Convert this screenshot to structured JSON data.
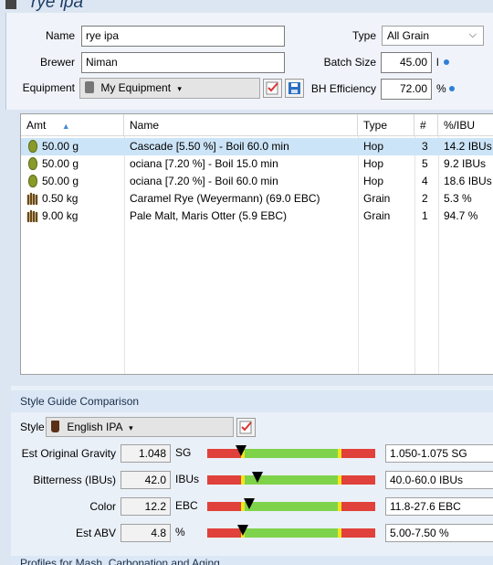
{
  "window": {
    "title": "rye ipa"
  },
  "recipe": {
    "name_label": "Name",
    "name_value": "rye ipa",
    "brewer_label": "Brewer",
    "brewer_value": "Niman",
    "equipment_label": "Equipment",
    "equipment_value": "My Equipment",
    "type_label": "Type",
    "type_value": "All Grain",
    "batch_label": "Batch Size",
    "batch_value": "45.00",
    "batch_unit": "l",
    "eff_label": "BH Efficiency",
    "eff_value": "72.00",
    "eff_unit": "%"
  },
  "table": {
    "headers": {
      "amt": "Amt",
      "name": "Name",
      "type": "Type",
      "num": "#",
      "ibu": "%/IBU"
    },
    "rows": [
      {
        "kind": "hop",
        "amt": "50.00 g",
        "name": "Cascade [5.50 %] - Boil 60.0 min",
        "type": "Hop",
        "num": "3",
        "ibu": "14.2 IBUs",
        "selected": true
      },
      {
        "kind": "hop",
        "amt": "50.00 g",
        "name": "ociana [7.20 %] - Boil 15.0 min",
        "type": "Hop",
        "num": "5",
        "ibu": "9.2 IBUs"
      },
      {
        "kind": "hop",
        "amt": "50.00 g",
        "name": "ociana [7.20 %] - Boil 60.0 min",
        "type": "Hop",
        "num": "4",
        "ibu": "18.6 IBUs"
      },
      {
        "kind": "grain",
        "amt": "0.50 kg",
        "name": "Caramel Rye (Weyermann) (69.0 EBC)",
        "type": "Grain",
        "num": "2",
        "ibu": "5.3 %"
      },
      {
        "kind": "grain",
        "amt": "9.00 kg",
        "name": "Pale Malt, Maris Otter (5.9 EBC)",
        "type": "Grain",
        "num": "1",
        "ibu": "94.7 %"
      }
    ]
  },
  "style": {
    "section_title": "Style Guide Comparison",
    "style_label": "Style",
    "style_value": "English IPA",
    "metrics": [
      {
        "label": "Est Original Gravity",
        "value": "1.048",
        "unit": "SG",
        "range": "1.050-1.075 SG",
        "marker_fraction": 0.2
      },
      {
        "label": "Bitterness (IBUs)",
        "value": "42.0",
        "unit": "IBUs",
        "range": "40.0-60.0 IBUs",
        "marker_fraction": 0.3
      },
      {
        "label": "Color",
        "value": "12.2",
        "unit": "EBC",
        "range": "11.8-27.6 EBC",
        "marker_fraction": 0.25
      },
      {
        "label": "Est ABV",
        "value": "4.8",
        "unit": "%",
        "range": "5.00-7.50 %",
        "marker_fraction": 0.21
      }
    ]
  },
  "bottom_section_title": "Profiles for Mash, Carbonation and Aging",
  "colors": {
    "gauge_red": "#e0413a",
    "gauge_yellow": "#f2e51d",
    "gauge_green": "#7fd34a",
    "selection": "#cce4f7"
  }
}
